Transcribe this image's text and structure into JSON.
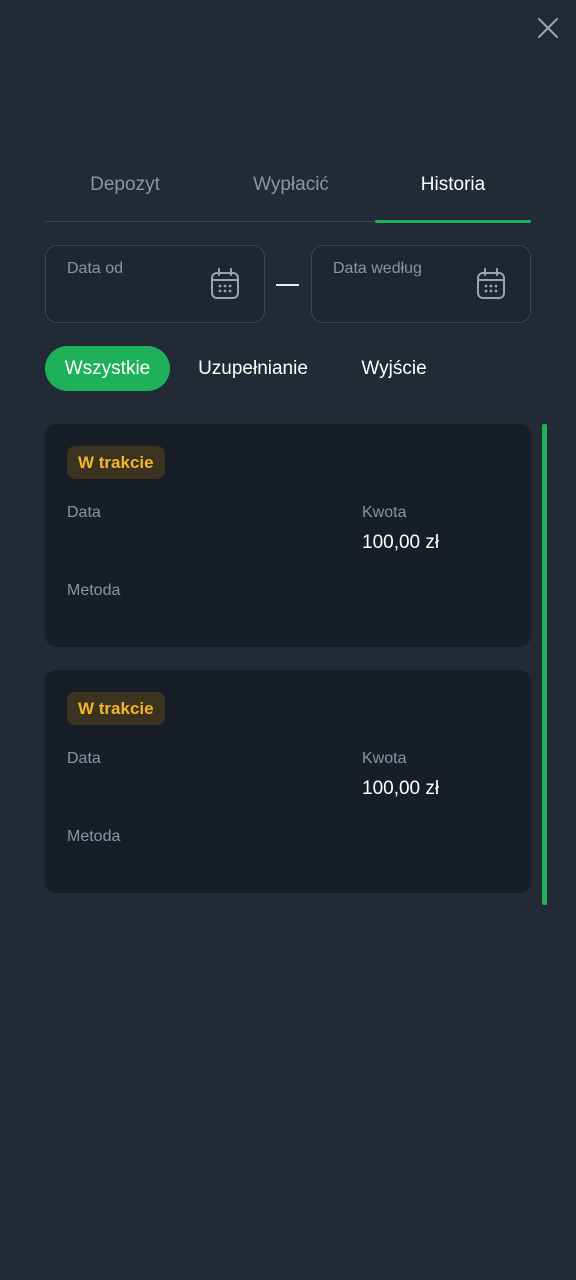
{
  "icons": {
    "close": "close-icon",
    "calendar": "calendar-icon"
  },
  "colors": {
    "accent": "#1fb05a",
    "status_pending": "#f2b628",
    "background": "#222a35",
    "card": "#181e27"
  },
  "tabs": [
    {
      "label": "Depozyt",
      "active": false
    },
    {
      "label": "Wypłacić",
      "active": false
    },
    {
      "label": "Historia",
      "active": true
    }
  ],
  "date_range": {
    "from_label": "Data od",
    "to_label": "Data według"
  },
  "filters": [
    {
      "label": "Wszystkie",
      "active": true
    },
    {
      "label": "Uzupełnianie",
      "active": false
    },
    {
      "label": "Wyjście",
      "active": false
    }
  ],
  "transactions": [
    {
      "status": "W trakcie",
      "date_label": "Data",
      "amount_label": "Kwota",
      "amount": "100,00 zł",
      "method_label": "Metoda"
    },
    {
      "status": "W trakcie",
      "date_label": "Data",
      "amount_label": "Kwota",
      "amount": "100,00 zł",
      "method_label": "Metoda"
    }
  ]
}
